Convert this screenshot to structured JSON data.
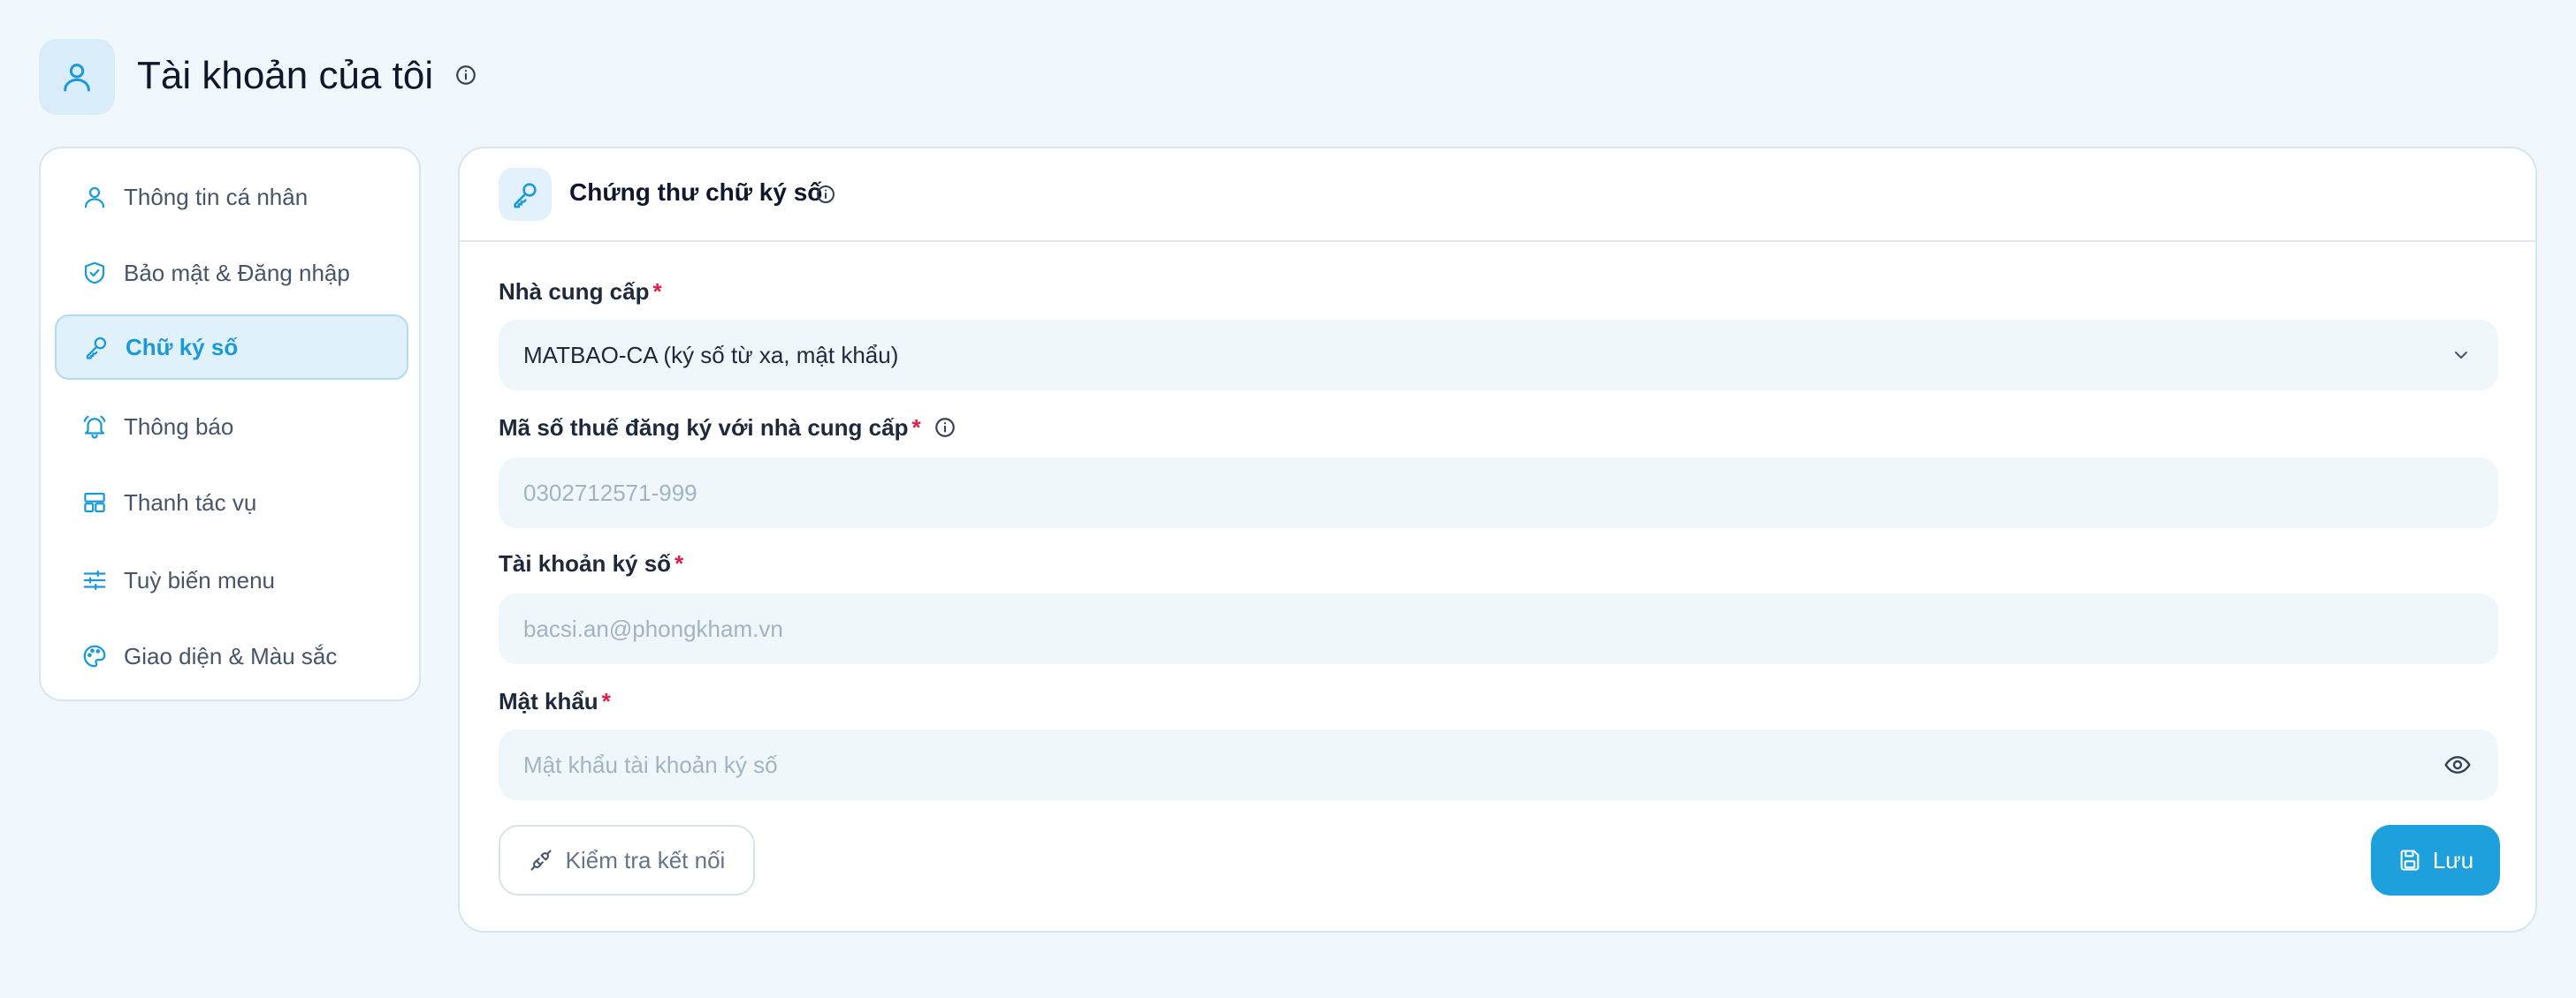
{
  "header": {
    "title": "Tài khoản của tôi",
    "icon": "user-icon"
  },
  "sidebar": {
    "items": [
      {
        "label": "Thông tin cá nhân",
        "icon": "user-icon",
        "active": false
      },
      {
        "label": "Bảo mật & Đăng nhập",
        "icon": "shield-check-icon",
        "active": false
      },
      {
        "label": "Chữ ký số",
        "icon": "key-icon",
        "active": true
      },
      {
        "label": "Thông báo",
        "icon": "bell-icon",
        "active": false
      },
      {
        "label": "Thanh tác vụ",
        "icon": "layout-icon",
        "active": false
      },
      {
        "label": "Tuỳ biến menu",
        "icon": "sliders-icon",
        "active": false
      },
      {
        "label": "Giao diện & Màu sắc",
        "icon": "palette-icon",
        "active": false
      }
    ]
  },
  "card": {
    "title": "Chứng thư chữ ký số",
    "icon": "key-icon",
    "provider": {
      "label": "Nhà cung cấp",
      "required_mark": "*",
      "value": "MATBAO-CA (ký số từ xa, mật khẩu)"
    },
    "tax_code": {
      "label": "Mã số thuế đăng ký với nhà cung cấp",
      "required_mark": "*",
      "placeholder": "0302712571-999"
    },
    "account": {
      "label": "Tài khoản ký số",
      "required_mark": "*",
      "placeholder": "bacsi.an@phongkham.vn"
    },
    "password": {
      "label": "Mật khẩu",
      "required_mark": "*",
      "placeholder": "Mật khẩu tài khoản ký số"
    },
    "test_button": {
      "label": "Kiểm tra kết nối",
      "icon": "plug-icon"
    },
    "save_button": {
      "label": "Lưu",
      "icon": "save-icon"
    }
  },
  "colors": {
    "accent": "#1ea0dc",
    "background": "#f0f7fd",
    "required": "#e11d48",
    "field_bg": "#eff7fb"
  }
}
